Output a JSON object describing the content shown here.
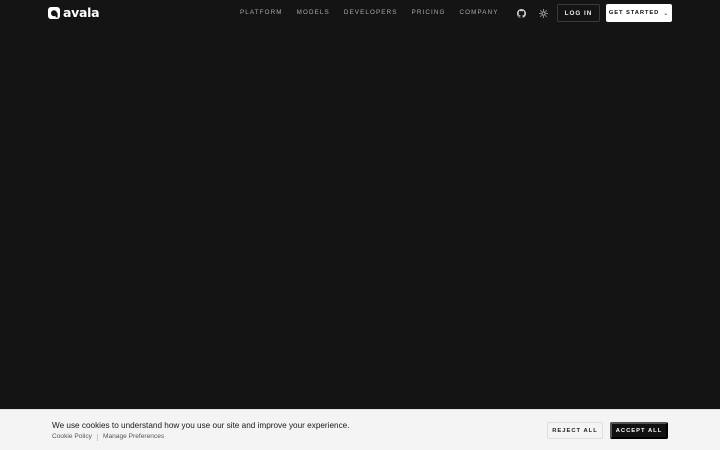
{
  "brand": {
    "name": "avala",
    "logo_icon": "avala-logo-icon",
    "text_color": "#ffffff"
  },
  "nav": {
    "items": [
      {
        "label": "PLATFORM"
      },
      {
        "label": "MODELS"
      },
      {
        "label": "DEVELOPERS"
      },
      {
        "label": "PRICING"
      },
      {
        "label": "COMPANY"
      }
    ]
  },
  "header_actions": {
    "github_icon": "github-icon",
    "theme_icon": "sun-icon",
    "login_label": "LOG IN",
    "get_started_label": "GET STARTED",
    "get_started_icon": "chevron-down-icon"
  },
  "cookie_banner": {
    "message": "We use cookies to understand how you use our site and improve your experience.",
    "cookie_policy_label": "Cookie Policy",
    "manage_preferences_label": "Manage Preferences",
    "reject_label": "REJECT ALL",
    "accept_label": "ACCEPT ALL"
  },
  "colors": {
    "background": "#141414",
    "banner_background": "#f4f4f4",
    "accept_button": "#111111",
    "primary_button": "#ffffff"
  }
}
